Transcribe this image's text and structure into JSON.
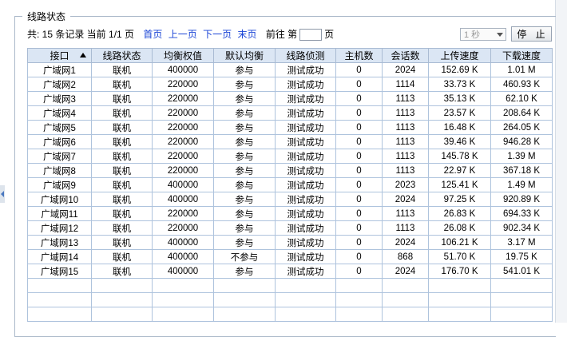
{
  "panel": {
    "title": "线路状态"
  },
  "pager": {
    "summary": "共: 15 条记录 当前 1/1 页",
    "first": "首页",
    "prev": "上一页",
    "next": "下一页",
    "last": "末页",
    "goto_prefix": "前往 第",
    "goto_suffix": "页",
    "page_value": ""
  },
  "controls": {
    "interval": "1 秒",
    "stop_label": "停 止"
  },
  "table": {
    "headers": [
      "接口",
      "线路状态",
      "均衡权值",
      "默认均衡",
      "线路侦测",
      "主机数",
      "会话数",
      "上传速度",
      "下载速度"
    ],
    "sorted_column": "接口",
    "sort_direction": "asc",
    "rows": [
      [
        "广域网1",
        "联机",
        "400000",
        "参与",
        "测试成功",
        "0",
        "2024",
        "152.69 K",
        "1.01 M"
      ],
      [
        "广域网2",
        "联机",
        "220000",
        "参与",
        "测试成功",
        "0",
        "1114",
        "33.73 K",
        "460.93 K"
      ],
      [
        "广域网3",
        "联机",
        "220000",
        "参与",
        "测试成功",
        "0",
        "1113",
        "35.13 K",
        "62.10 K"
      ],
      [
        "广域网4",
        "联机",
        "220000",
        "参与",
        "测试成功",
        "0",
        "1113",
        "23.57 K",
        "208.64 K"
      ],
      [
        "广域网5",
        "联机",
        "220000",
        "参与",
        "测试成功",
        "0",
        "1113",
        "16.48 K",
        "264.05 K"
      ],
      [
        "广域网6",
        "联机",
        "220000",
        "参与",
        "测试成功",
        "0",
        "1113",
        "39.46 K",
        "946.28 K"
      ],
      [
        "广域网7",
        "联机",
        "220000",
        "参与",
        "测试成功",
        "0",
        "1113",
        "145.78 K",
        "1.39 M"
      ],
      [
        "广域网8",
        "联机",
        "220000",
        "参与",
        "测试成功",
        "0",
        "1113",
        "22.97 K",
        "367.18 K"
      ],
      [
        "广域网9",
        "联机",
        "400000",
        "参与",
        "测试成功",
        "0",
        "2023",
        "125.41 K",
        "1.49 M"
      ],
      [
        "广域网10",
        "联机",
        "400000",
        "参与",
        "测试成功",
        "0",
        "2024",
        "97.25 K",
        "920.89 K"
      ],
      [
        "广域网11",
        "联机",
        "220000",
        "参与",
        "测试成功",
        "0",
        "1113",
        "26.83 K",
        "694.33 K"
      ],
      [
        "广域网12",
        "联机",
        "220000",
        "参与",
        "测试成功",
        "0",
        "1113",
        "26.08 K",
        "902.34 K"
      ],
      [
        "广域网13",
        "联机",
        "400000",
        "参与",
        "测试成功",
        "0",
        "2024",
        "106.21 K",
        "3.17 M"
      ],
      [
        "广域网14",
        "联机",
        "400000",
        "不参与",
        "测试成功",
        "0",
        "868",
        "51.70 K",
        "19.75 K"
      ],
      [
        "广域网15",
        "联机",
        "400000",
        "参与",
        "测试成功",
        "0",
        "2024",
        "176.70 K",
        "541.01 K"
      ]
    ],
    "empty_rows": 3
  }
}
